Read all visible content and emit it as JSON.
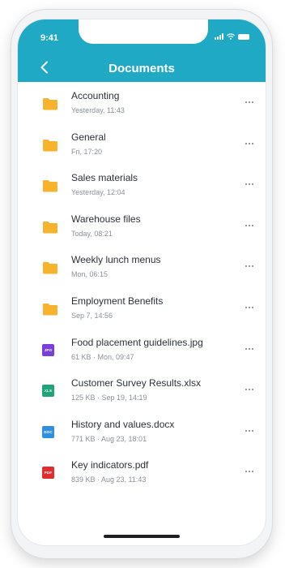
{
  "status_bar": {
    "time": "9:41"
  },
  "header": {
    "title": "Documents"
  },
  "files": [
    {
      "name": "Accounting",
      "meta": "Yesterday, 11:43",
      "icon": "folder-icon",
      "kind": "folder"
    },
    {
      "name": "General",
      "meta": "Fri, 17:20",
      "icon": "folder-icon",
      "kind": "folder"
    },
    {
      "name": "Sales materials",
      "meta": "Yesterday, 12:04",
      "icon": "folder-icon",
      "kind": "folder"
    },
    {
      "name": "Warehouse files",
      "meta": "Today, 08:21",
      "icon": "folder-icon",
      "kind": "folder"
    },
    {
      "name": "Weekly lunch menus",
      "meta": "Mon, 06:15",
      "icon": "folder-icon",
      "kind": "folder"
    },
    {
      "name": "Employment Benefits",
      "meta": "Sep 7, 14:56",
      "icon": "folder-icon",
      "kind": "folder"
    },
    {
      "name": "Food placement guidelines.jpg",
      "meta": "61 KB · Mon, 09:47",
      "icon": "jpg-file-icon",
      "kind": "file",
      "badge": "JPG",
      "color": "#7b3fd9"
    },
    {
      "name": "Customer Survey Results.xlsx",
      "meta": "125 KB · Sep 19, 14:19",
      "icon": "xlsx-file-icon",
      "kind": "file",
      "badge": "XLS",
      "color": "#1fa37a"
    },
    {
      "name": "History and values.docx",
      "meta": "771 KB · Aug 23, 18:01",
      "icon": "docx-file-icon",
      "kind": "file",
      "badge": "DOC",
      "color": "#2f8fe0"
    },
    {
      "name": "Key indicators.pdf",
      "meta": "839 KB · Aug 23, 11:43",
      "icon": "pdf-file-icon",
      "kind": "file",
      "badge": "PDF",
      "color": "#e12d2d"
    }
  ],
  "colors": {
    "header": "#1fa9c4",
    "folder": "#f7b32b"
  }
}
